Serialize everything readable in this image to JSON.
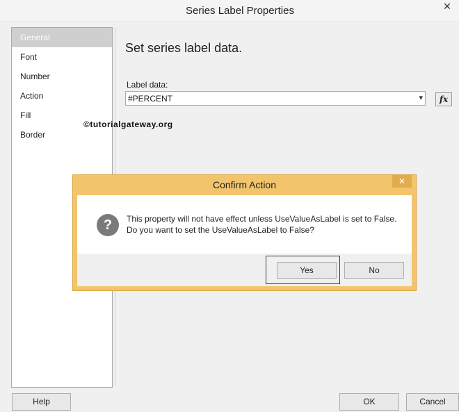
{
  "window": {
    "title": "Series Label Properties",
    "close_glyph": "✕"
  },
  "nav": {
    "items": [
      {
        "label": "General",
        "selected": true
      },
      {
        "label": "Font",
        "selected": false
      },
      {
        "label": "Number",
        "selected": false
      },
      {
        "label": "Action",
        "selected": false
      },
      {
        "label": "Fill",
        "selected": false
      },
      {
        "label": "Border",
        "selected": false
      }
    ]
  },
  "content": {
    "heading": "Set series label data.",
    "label_data": {
      "label": "Label data:",
      "value": "#PERCENT",
      "dropdown_glyph": "▾"
    },
    "fx_label": "fx",
    "watermark": "©tutorialgateway.org"
  },
  "dialog": {
    "title": "Confirm Action",
    "close_glyph": "✕",
    "icon_glyph": "?",
    "message_line1": "This property will not have effect unless UseValueAsLabel is set to False.",
    "message_line2": "Do you want to set the UseValueAsLabel to False?",
    "yes_label": "Yes",
    "no_label": "No"
  },
  "footer": {
    "help_label": "Help",
    "ok_label": "OK",
    "cancel_label": "Cancel"
  }
}
